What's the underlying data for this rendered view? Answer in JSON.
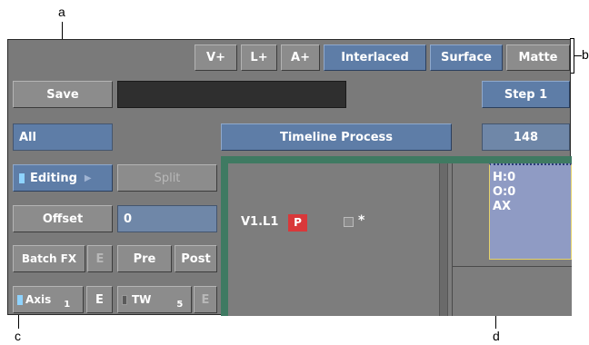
{
  "callouts": {
    "a": "a",
    "b": "b",
    "c": "c",
    "d": "d"
  },
  "toolbar": {
    "v_plus": "V+",
    "l_plus": "L+",
    "a_plus": "A+",
    "interlaced": "Interlaced",
    "surface": "Surface",
    "matte": "Matte"
  },
  "left": {
    "save": "Save",
    "all": "All",
    "editing": "Editing",
    "split": "Split",
    "offset": "Offset",
    "offset_value": "0",
    "batch_fx": "Batch FX",
    "e": "E",
    "pre": "Pre",
    "post": "Post",
    "axis": "Axis",
    "axis_num": "1",
    "tw": "TW",
    "tw_num": "5"
  },
  "center": {
    "timeline_process": "Timeline Process"
  },
  "right": {
    "step": "Step 1",
    "frame": "148"
  },
  "track": {
    "name": "V1.L1",
    "p_badge": "P",
    "star": "*"
  },
  "node": {
    "h": "H:0",
    "o": "O:0",
    "ax": "AX"
  },
  "colors": {
    "panel": "#7a7a7a",
    "blue_button": "#5e7da7",
    "green_frame": "#3f7a62",
    "node_fill": "#8f9bc4",
    "node_border": "#e6d36a",
    "p_badge": "#d9383a"
  }
}
